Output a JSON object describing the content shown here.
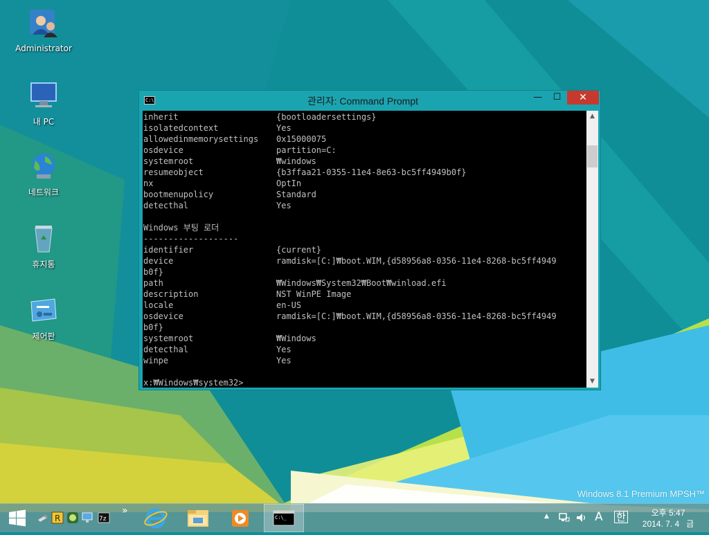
{
  "desktop": {
    "icons": [
      {
        "label": "Administrator"
      },
      {
        "label": "내 PC"
      },
      {
        "label": "네트워크"
      },
      {
        "label": "휴지통"
      },
      {
        "label": "제어판"
      }
    ],
    "watermark": "Windows 8.1 Premium MPSH™"
  },
  "window": {
    "title": "관리자: Command Prompt",
    "icon_text": "C:\\",
    "minimize_glyph": "—",
    "maximize_glyph": "☐",
    "close_glyph": "✕"
  },
  "console": {
    "lines": [
      {
        "key": "inherit",
        "value": "{bootloadersettings}"
      },
      {
        "key": "isolatedcontext",
        "value": "Yes"
      },
      {
        "key": "allowedinmemorysettings",
        "value": "0x15000075"
      },
      {
        "key": "osdevice",
        "value": "partition=C:"
      },
      {
        "key": "systemroot",
        "value": "₩windows"
      },
      {
        "key": "resumeobject",
        "value": "{b3ffaa21-0355-11e4-8e63-bc5ff4949b0f}"
      },
      {
        "key": "nx",
        "value": "OptIn"
      },
      {
        "key": "bootmenupolicy",
        "value": "Standard"
      },
      {
        "key": "detecthal",
        "value": "Yes"
      },
      {
        "key": "",
        "value": ""
      },
      {
        "key": "Windows 부팅 로더",
        "value": ""
      },
      {
        "key": "-------------------",
        "value": ""
      },
      {
        "key": "identifier",
        "value": "{current}"
      },
      {
        "key": "device",
        "value": "ramdisk=[C:]₩boot.WIM,{d58956a8-0356-11e4-8268-bc5ff4949"
      },
      {
        "key": "b0f}",
        "value": ""
      },
      {
        "key": "path",
        "value": "₩Windows₩System32₩Boot₩winload.efi"
      },
      {
        "key": "description",
        "value": "NST WinPE Image"
      },
      {
        "key": "locale",
        "value": "en-US"
      },
      {
        "key": "osdevice",
        "value": "ramdisk=[C:]₩boot.WIM,{d58956a8-0356-11e4-8268-bc5ff4949"
      },
      {
        "key": "b0f}",
        "value": ""
      },
      {
        "key": "systemroot",
        "value": "₩Windows"
      },
      {
        "key": "detecthal",
        "value": "Yes"
      },
      {
        "key": "winpe",
        "value": "Yes"
      },
      {
        "key": "",
        "value": ""
      },
      {
        "key": "x:₩Windows₩system32>",
        "value": ""
      }
    ]
  },
  "taskbar": {
    "overflow_chevron": "»",
    "tray": {
      "up_arrow": "▲",
      "ime_mode": "A",
      "ime_lang": "한"
    },
    "clock": {
      "time": "오후 5:47",
      "date": "2014. 7. 4",
      "weekday": "금"
    }
  }
}
